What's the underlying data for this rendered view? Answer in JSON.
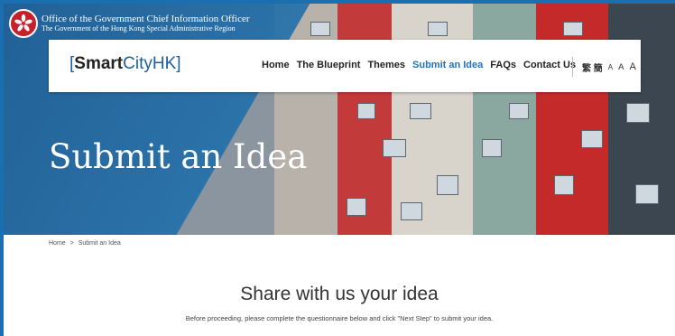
{
  "header": {
    "org_line1": "Office of the Government Chief Information Officer",
    "org_line2": "The Government of the Hong Kong Special Administrative Region"
  },
  "brand": {
    "open": "[",
    "bold": "Smart",
    "rest": "CityHK",
    "close": "]"
  },
  "nav": {
    "items": [
      {
        "label": "Home"
      },
      {
        "label": "The Blueprint"
      },
      {
        "label": "Themes"
      },
      {
        "label": "Submit an Idea"
      },
      {
        "label": "FAQs"
      },
      {
        "label": "Contact Us"
      }
    ],
    "active_index": 3,
    "lang_label": "繁 簡",
    "font_small": "A",
    "font_medium": "A",
    "font_large": "A"
  },
  "hero": {
    "title": "Submit an Idea"
  },
  "breadcrumb": {
    "home": "Home",
    "separator": ">",
    "current": "Submit an Idea"
  },
  "main": {
    "heading": "Share with us your idea",
    "instructions": "Before proceeding, please complete the questionnaire below and click \"Next Step\" to submit your idea."
  },
  "colors": {
    "accent": "#1e73be",
    "brand_blue": "#1d5fa0",
    "overlay_blue": "#1f6eaa",
    "emblem_red": "#c8202a"
  }
}
